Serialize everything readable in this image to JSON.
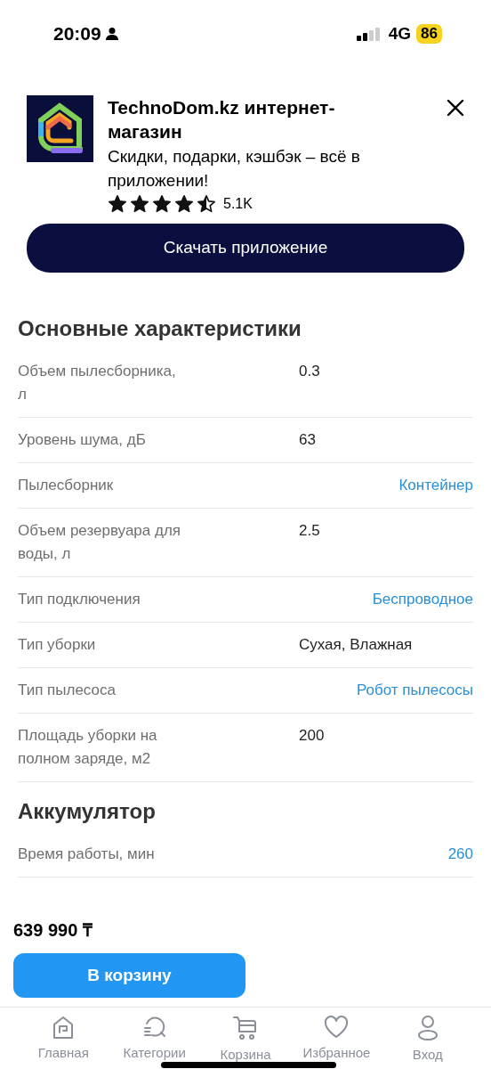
{
  "status_bar": {
    "time": "20:09",
    "network": "4G",
    "battery": "86"
  },
  "app_banner": {
    "title": "TechnoDom.kz интернет-магазин",
    "subtitle": "Скидки, подарки, кэшбэк – всё в приложении!",
    "stars": 4.5,
    "rating_count": "5.1K",
    "button": "Скачать приложение"
  },
  "sections": [
    {
      "title": "Основные характеристики",
      "rows": [
        {
          "label": "Объем пылесборника, л",
          "value": "0.3",
          "link": false
        },
        {
          "label": "Уровень шума, дБ",
          "value": "63",
          "link": false
        },
        {
          "label": "Пылесборник",
          "value": "Контейнер",
          "link": true
        },
        {
          "label": "Объем резервуара для воды, л",
          "value": "2.5",
          "link": false
        },
        {
          "label": "Тип подключения",
          "value": "Беспроводное",
          "link": true
        },
        {
          "label": "Тип уборки",
          "value": "Сухая, Влажная",
          "link": false
        },
        {
          "label": "Тип пылесоса",
          "value": "Робот пылесосы",
          "link": true
        },
        {
          "label": "Площадь уборки на полном заряде, м2",
          "value": "200",
          "link": false
        }
      ]
    },
    {
      "title": "Аккумулятор",
      "rows": [
        {
          "label": "Время работы, мин",
          "value": "260",
          "link": true
        }
      ]
    }
  ],
  "price": "639 990 ₸",
  "cart_button": "В корзину",
  "bottom_nav": [
    {
      "label": "Главная",
      "kind": "home"
    },
    {
      "label": "Категории",
      "kind": "categories"
    },
    {
      "label": "Корзина",
      "kind": "cart"
    },
    {
      "label": "Избранное",
      "kind": "heart"
    },
    {
      "label": "Вход",
      "kind": "user"
    }
  ]
}
